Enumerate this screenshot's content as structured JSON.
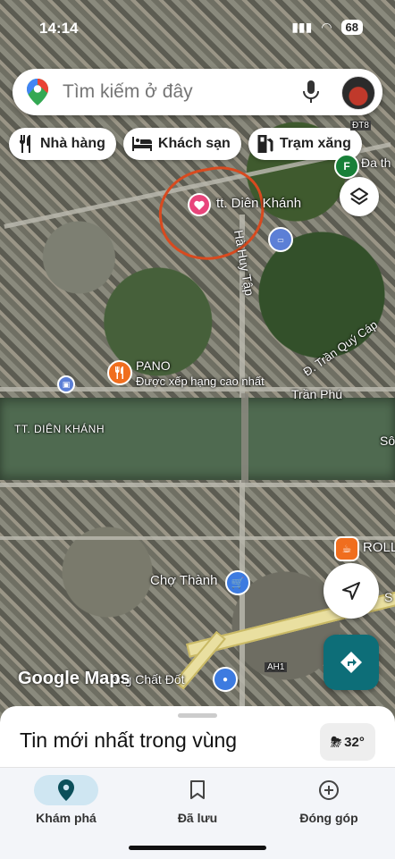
{
  "status_bar": {
    "time": "14:14",
    "battery": "68"
  },
  "search": {
    "placeholder": "Tìm kiếm ở đây"
  },
  "chips": [
    {
      "label": "Nhà hàng",
      "icon": "restaurant-icon"
    },
    {
      "label": "Khách sạn",
      "icon": "hotel-icon"
    },
    {
      "label": "Trạm xăng",
      "icon": "gas-station-icon"
    }
  ],
  "map_labels": {
    "dien_khanh_pin": "tt. Diên Khánh",
    "ha_huy_tap": "Hà Huy Tập",
    "tran_quy_cap": "Đ. Trần Quý Cáp",
    "pano": "PANO",
    "pano_sub": "Được xếp hạng cao nhất",
    "tran_phu": "Trần Phú",
    "tt_dien_khanh": "TT. DIÊN KHÁNH",
    "cho_thanh": "Chợ Thành",
    "roll": "ROLL",
    "chat_dot": "ăng Chất Đốt",
    "ah1": "AH1",
    "dt8": "ĐT8",
    "da_th": "Đa th",
    "so": "Sô",
    "s_label": "S"
  },
  "google_logo": "Google Maps",
  "sheet": {
    "title": "Tin mới nhất trong vùng",
    "temperature": "32°"
  },
  "nav": [
    {
      "label": "Khám phá",
      "icon": "explore-pin-icon",
      "active": true
    },
    {
      "label": "Đã lưu",
      "icon": "bookmark-icon",
      "active": false
    },
    {
      "label": "Đóng góp",
      "icon": "add-circle-icon",
      "active": false
    }
  ],
  "colors": {
    "annotation_circle": "#d84a1f",
    "directions": "#0d6e78",
    "active_nav": "#cfe6f2"
  }
}
